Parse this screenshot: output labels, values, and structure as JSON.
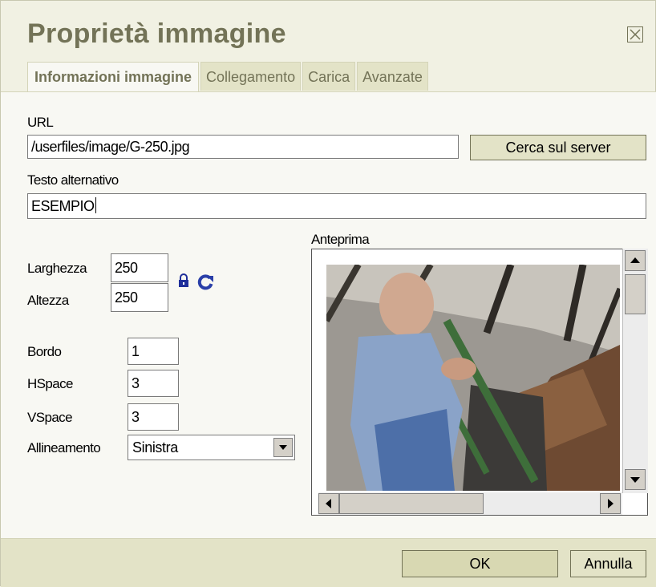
{
  "dialog": {
    "title": "Proprietà immagine"
  },
  "tabs": [
    {
      "label": "Informazioni immagine",
      "active": true
    },
    {
      "label": "Collegamento",
      "active": false
    },
    {
      "label": "Carica",
      "active": false
    },
    {
      "label": "Avanzate",
      "active": false
    }
  ],
  "form": {
    "url_label": "URL",
    "url_value": "/userfiles/image/G-250.jpg",
    "browse_button": "Cerca sul server",
    "alt_label": "Testo alternativo",
    "alt_value": "ESEMPIO",
    "width_label": "Larghezza",
    "width_value": "250",
    "height_label": "Altezza",
    "height_value": "250",
    "border_label": "Bordo",
    "border_value": "1",
    "hspace_label": "HSpace",
    "hspace_value": "3",
    "vspace_label": "VSpace",
    "vspace_value": "3",
    "align_label": "Allineamento",
    "align_value": "Sinistra"
  },
  "preview": {
    "label": "Anteprima"
  },
  "footer": {
    "ok_label": "OK",
    "cancel_label": "Annulla"
  },
  "colors": {
    "title": "#737357",
    "tab_bg": "#e3e3c7",
    "panel_bg": "#f8f8f3",
    "lock": "#1f2f9a",
    "reset": "#2a3fa8"
  },
  "icons": [
    "close-icon",
    "lock-icon",
    "reset-size-icon",
    "arrow-up-icon",
    "arrow-down-icon",
    "arrow-left-icon",
    "arrow-right-icon",
    "chevron-down-icon"
  ]
}
